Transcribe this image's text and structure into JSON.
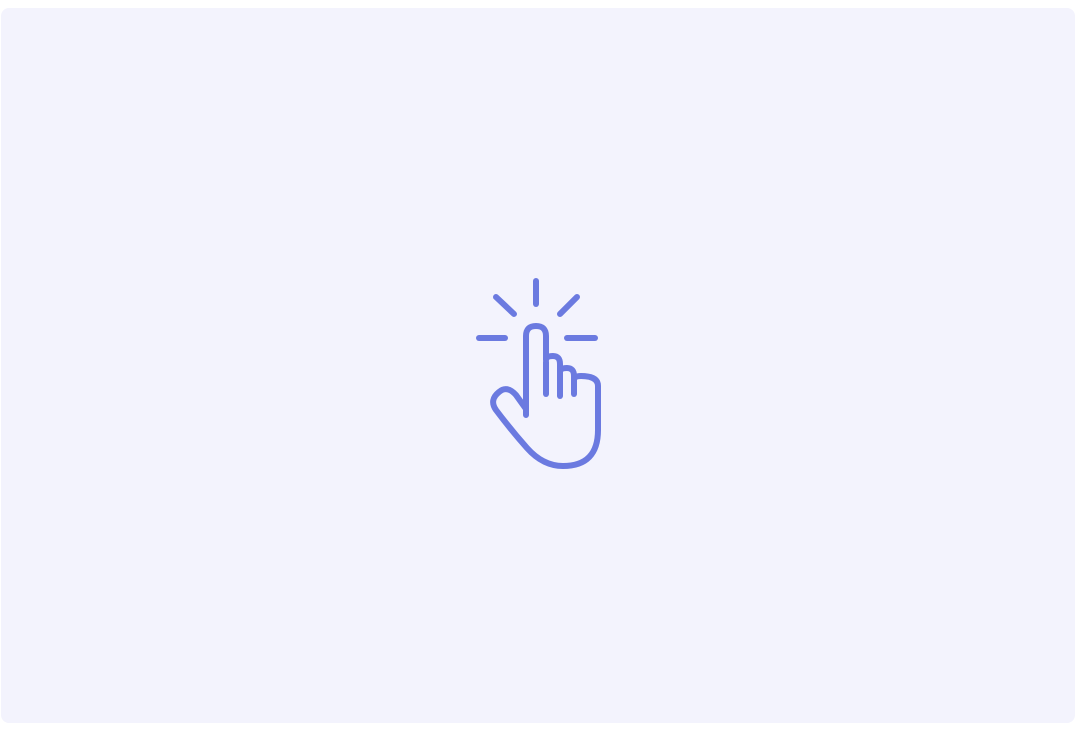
{
  "panel": {
    "background": "#f3f3fd"
  },
  "icon": {
    "name": "tap-hand-icon",
    "color": "#6b7ae0"
  }
}
